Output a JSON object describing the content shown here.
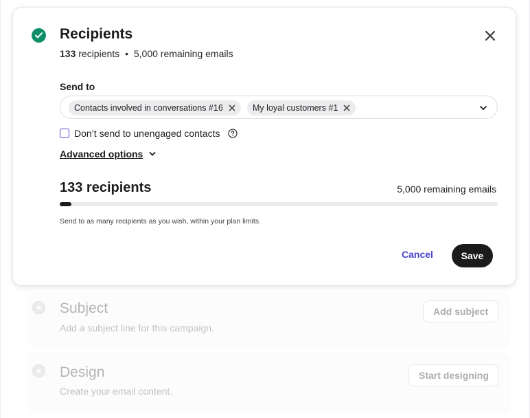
{
  "recipients_step": {
    "title": "Recipients",
    "summary_count": "133",
    "summary_count_label": "recipients",
    "summary_separator": "•",
    "summary_remaining": "5,000 remaining emails",
    "send_to_label": "Send to",
    "selected_lists": [
      {
        "label": "Contacts involved in conversations #16"
      },
      {
        "label": "My loyal customers #1"
      }
    ],
    "unengaged_checkbox": {
      "label": "Don’t send to unengaged contacts",
      "checked": false
    },
    "advanced_options_label": "Advanced options",
    "recipients_total": "133 recipients",
    "remaining_emails": "5,000 remaining emails",
    "usage_fraction": 0.027,
    "hint": "Send to as many recipients as you wish, within your plan limits.",
    "cancel_label": "Cancel",
    "save_label": "Save"
  },
  "subject_step": {
    "title": "Subject",
    "description": "Add a subject line for this campaign.",
    "button_label": "Add subject"
  },
  "design_step": {
    "title": "Design",
    "description": "Create your email content.",
    "button_label": "Start designing"
  },
  "colors": {
    "accent": "#4a47c9",
    "success": "#0e8f6a",
    "primary_button": "#1b1b1b"
  },
  "icons": [
    "check-circle-icon",
    "close-icon",
    "chip-remove-icon",
    "chevron-down-icon",
    "help-circle-icon",
    "step-pending-icon"
  ]
}
